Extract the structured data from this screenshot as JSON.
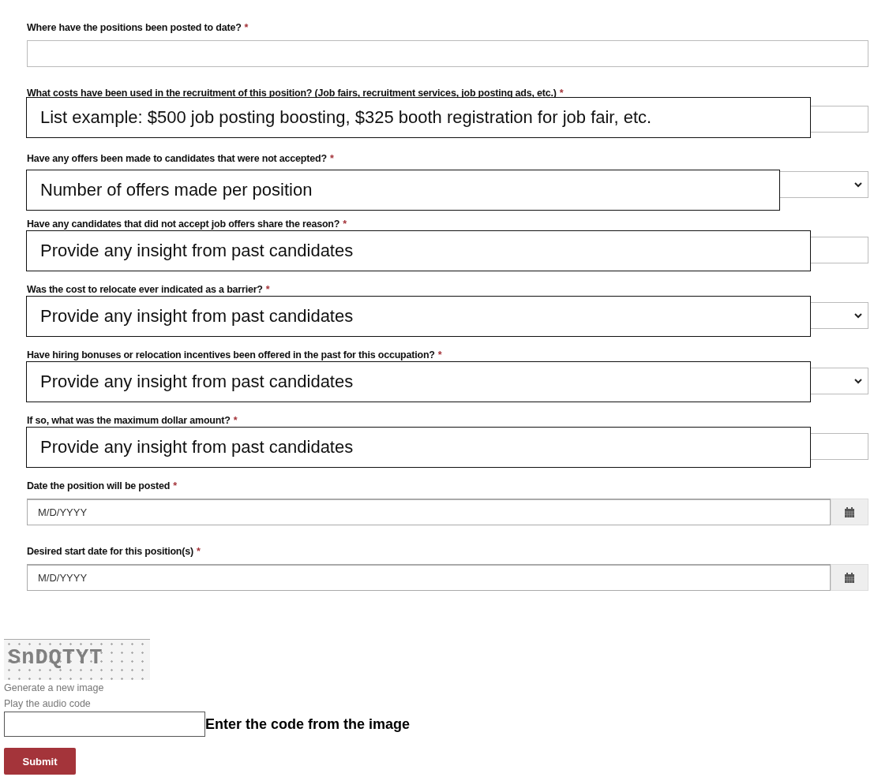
{
  "questions": [
    {
      "kind": "text",
      "label": "Where have the positions been posted to date?",
      "required_mark": "*"
    },
    {
      "kind": "text",
      "label": "What costs have been used in the recruitment of this position? (Job fairs, recruitment services, job posting ads, etc.)",
      "required_mark": "*",
      "callout": "List example: $500 job posting boosting, $325 booth registration for job fair, etc."
    },
    {
      "kind": "select",
      "label": "Have any offers been made to candidates that were not accepted?",
      "required_mark": "*",
      "callout": "Number of offers made per position"
    },
    {
      "kind": "text",
      "label": "Have any candidates that did not accept job offers share the reason?",
      "required_mark": "*",
      "callout": "Provide any insight from past candidates"
    },
    {
      "kind": "select",
      "label": "Was the cost to relocate ever indicated as a barrier?",
      "required_mark": "*",
      "callout": "Provide any insight from past candidates"
    },
    {
      "kind": "select",
      "label": "Have hiring bonuses or relocation incentives been offered in the past for this occupation?",
      "required_mark": "*",
      "callout": "Provide any insight from past candidates"
    },
    {
      "kind": "text",
      "label": "If so, what was the maximum dollar amount?",
      "required_mark": "*",
      "callout": "Provide any insight from past candidates"
    },
    {
      "kind": "date",
      "label": "Date the position will be posted",
      "required_mark": "*",
      "placeholder": "M/D/YYYY"
    },
    {
      "kind": "date",
      "label": "Desired start date for this position(s)",
      "required_mark": "*",
      "placeholder": "M/D/YYYY"
    }
  ],
  "captcha": {
    "code": "SnDQTYT",
    "links": [
      "Generate a new image",
      "Play the audio code"
    ],
    "input_label": "Enter the code from the image"
  },
  "submit": "Submit"
}
